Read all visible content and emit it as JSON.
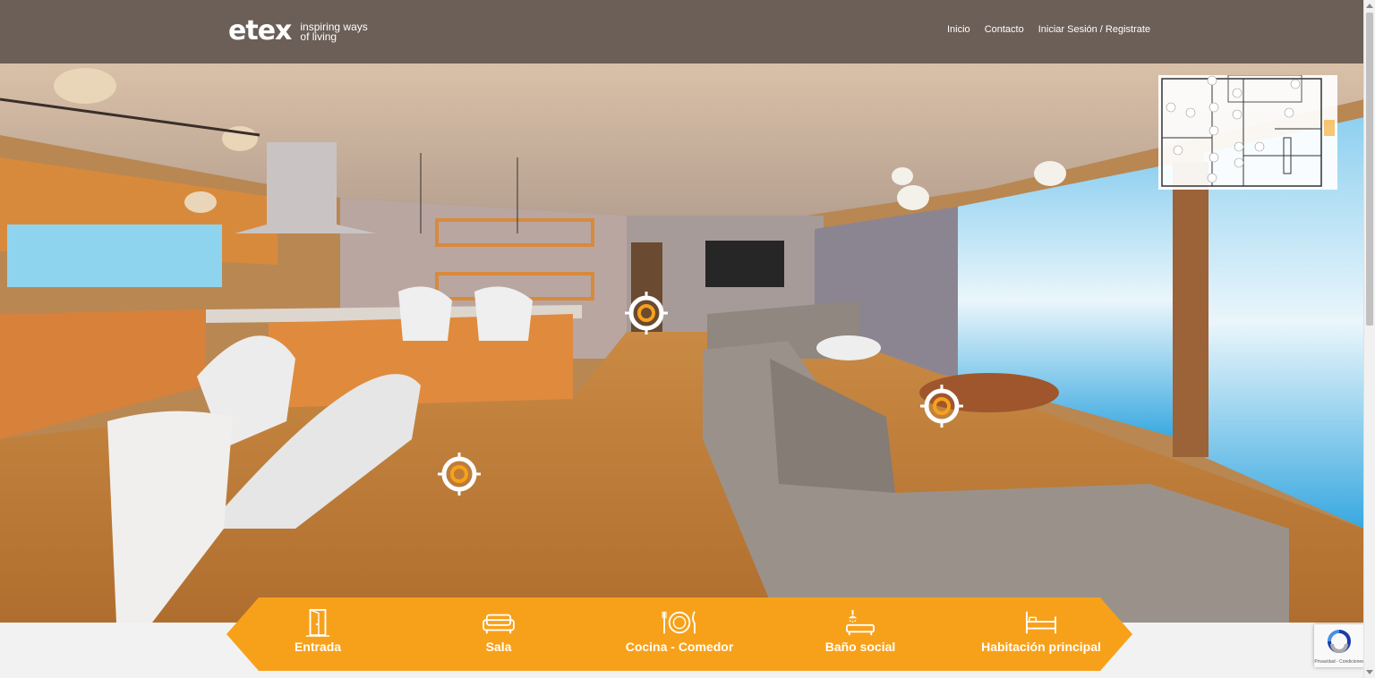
{
  "brand": {
    "logo_text": "etex",
    "tagline_line1": "inspiring ways",
    "tagline_line2": "of living"
  },
  "nav": [
    {
      "label": "Inicio"
    },
    {
      "label": "Contacto"
    },
    {
      "label": "Iniciar Sesión / Registrate"
    }
  ],
  "rooms": [
    {
      "label": "Entrada",
      "icon": "door-icon"
    },
    {
      "label": "Sala",
      "icon": "sofa-icon"
    },
    {
      "label": "Cocina - Comedor",
      "icon": "plate-cutlery-icon"
    },
    {
      "label": "Baño social",
      "icon": "shower-icon"
    },
    {
      "label": "Habitación principal",
      "icon": "bed-icon"
    }
  ],
  "hotspots": [
    {
      "name": "hotspot-hallway",
      "icon": "target-icon"
    },
    {
      "name": "hotspot-living",
      "icon": "target-icon"
    },
    {
      "name": "hotspot-dining",
      "icon": "target-icon"
    }
  ],
  "recaptcha": {
    "text": "Privacidad - Condiciones"
  },
  "colors": {
    "accent": "#f7a11a",
    "topbar": "#6b5f58",
    "hotspot_ring": "#f7a11a"
  }
}
